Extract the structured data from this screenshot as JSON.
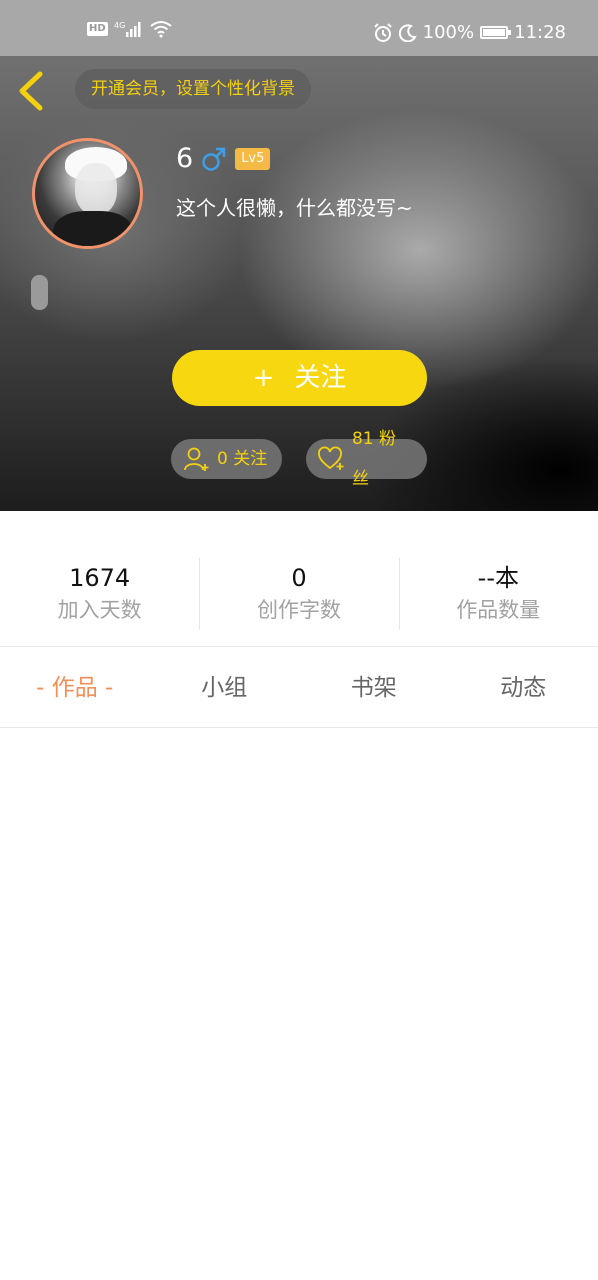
{
  "status_bar": {
    "network_badge": "HD",
    "network_type": "4G",
    "battery_percent": "100%",
    "time": "11:28",
    "icons": [
      "signal-icon",
      "wifi-icon",
      "alarm-icon",
      "moon-icon",
      "battery-icon"
    ]
  },
  "header": {
    "vip_banner": "开通会员，设置个性化背景",
    "back_icon": "chevron-left-icon"
  },
  "profile": {
    "username": "6",
    "gender_icon": "male-icon",
    "level": "Lv5",
    "bio": "这个人很懒，什么都没写~"
  },
  "actions": {
    "follow_plus": "+",
    "follow_label": "关注",
    "following_text": "0 关注",
    "fans_text": "81 粉丝"
  },
  "stats": [
    {
      "value": "1674",
      "label": "加入天数"
    },
    {
      "value": "0",
      "label": "创作字数"
    },
    {
      "value": "--本",
      "label": "作品数量"
    }
  ],
  "tabs": [
    {
      "label": "- 作品 -",
      "active": true
    },
    {
      "label": "小组",
      "active": false
    },
    {
      "label": "书架",
      "active": false
    },
    {
      "label": "动态",
      "active": false
    }
  ],
  "colors": {
    "accent_yellow": "#f7d70f",
    "active_tab": "#ef8f5a",
    "level_badge": "#f5b945",
    "male_blue": "#3aa0e8"
  }
}
